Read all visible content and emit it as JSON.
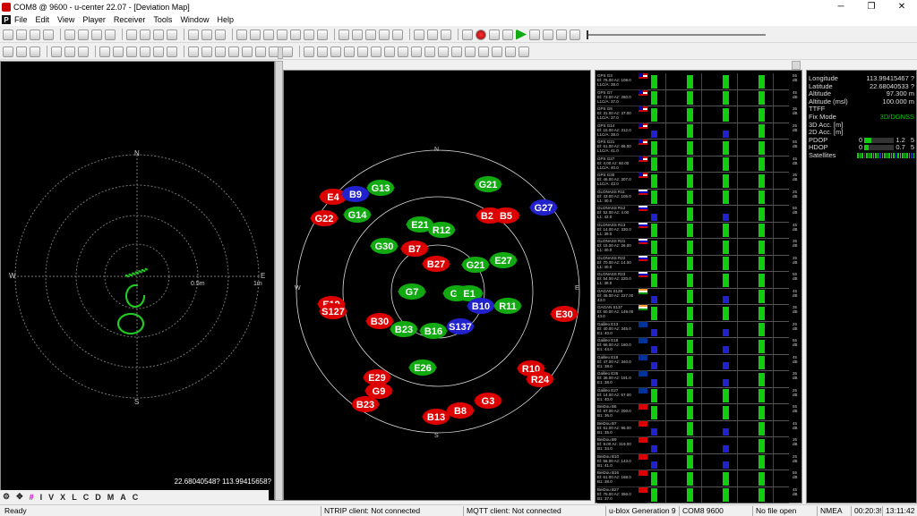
{
  "window": {
    "title": "COM8 @ 9600 - u-center 22.07 - [Deviation Map]"
  },
  "menu": [
    "File",
    "Edit",
    "View",
    "Player",
    "Receiver",
    "Tools",
    "Window",
    "Help"
  ],
  "deviation": {
    "coords": "22.68040548? 113.99415658?",
    "labels": {
      "n": "N",
      "s": "S",
      "e": "E",
      "w": "W",
      "r1": "0.5m",
      "r2": "1m"
    }
  },
  "skyview": {
    "labels": {
      "n": "N",
      "s": "S",
      "e": "E",
      "w": "W"
    },
    "sats": [
      {
        "id": "E4",
        "c": "red"
      },
      {
        "id": "B9",
        "c": "blue"
      },
      {
        "id": "G13",
        "c": "green"
      },
      {
        "id": "G21",
        "c": "green"
      },
      {
        "id": "G27",
        "c": "blue"
      },
      {
        "id": "G22",
        "c": "red"
      },
      {
        "id": "G14",
        "c": "green"
      },
      {
        "id": "E21",
        "c": "green"
      },
      {
        "id": "R12",
        "c": "green"
      },
      {
        "id": "B28",
        "c": "red"
      },
      {
        "id": "B5",
        "c": "red"
      },
      {
        "id": "G30",
        "c": "green"
      },
      {
        "id": "B7",
        "c": "red"
      },
      {
        "id": "B27",
        "c": "red"
      },
      {
        "id": "G21",
        "c": "green"
      },
      {
        "id": "E27",
        "c": "green"
      },
      {
        "id": "G7",
        "c": "green"
      },
      {
        "id": "G6",
        "c": "green"
      },
      {
        "id": "E1",
        "c": "green"
      },
      {
        "id": "B10",
        "c": "blue"
      },
      {
        "id": "R11",
        "c": "green"
      },
      {
        "id": "E19",
        "c": "red"
      },
      {
        "id": "S127",
        "c": "red"
      },
      {
        "id": "E30",
        "c": "red"
      },
      {
        "id": "B30",
        "c": "red"
      },
      {
        "id": "B23",
        "c": "green"
      },
      {
        "id": "B16",
        "c": "green"
      },
      {
        "id": "S137",
        "c": "blue"
      },
      {
        "id": "E26",
        "c": "green"
      },
      {
        "id": "E29",
        "c": "red"
      },
      {
        "id": "G9",
        "c": "red"
      },
      {
        "id": "B23",
        "c": "red"
      },
      {
        "id": "R10",
        "c": "red"
      },
      {
        "id": "R24",
        "c": "red"
      },
      {
        "id": "G3",
        "c": "red"
      },
      {
        "id": "B8",
        "c": "red"
      },
      {
        "id": "B13",
        "c": "red"
      }
    ]
  },
  "satlist": [
    {
      "name": "GPS G3",
      "l2": "El: 76.00 Az: 108.0",
      "l3": "L1C/A: 38.0",
      "flag": "us"
    },
    {
      "name": "GPS G7",
      "l2": "El: 73.00 Az: 260.0",
      "l3": "L1C/A: 37.0",
      "flag": "us"
    },
    {
      "name": "GPS G8",
      "l2": "El: 31.00 Az: 37.00",
      "l3": "L1C/A: 37.0",
      "flag": "us"
    },
    {
      "name": "GPS G14",
      "l2": "El: 15.00 Az: 312.0",
      "l3": "L1C/A: 38.0",
      "flag": "us"
    },
    {
      "name": "GPS G21",
      "l2": "El: 61.00 Az: 86.00",
      "l3": "L1C/A: 41.0",
      "flag": "us"
    },
    {
      "name": "GPS G27",
      "l2": "El: 4.00 Az: 60.00",
      "l3": "L1C/A: 40.0",
      "flag": "us"
    },
    {
      "name": "GPS G30",
      "l2": "El: 46.00 Az: 307.0",
      "l3": "L1C/A: 42.0",
      "flag": "us"
    },
    {
      "name": "GLONASS R11",
      "l2": "El: 43.00 Az: 105.0",
      "l3": "L1: 40.0",
      "flag": "ru"
    },
    {
      "name": "GLONASS R12",
      "l2": "El: 52.00 Az: 4.00",
      "l3": "L1: 42.0",
      "flag": "ru"
    },
    {
      "name": "GLONASS R13",
      "l2": "El: 14.00 Az: 330.0",
      "l3": "L1: 39.0",
      "flag": "ru"
    },
    {
      "name": "GLONASS R21",
      "l2": "El: 15.00 Az: 26.00",
      "l3": "L1: 40.0",
      "flag": "ru"
    },
    {
      "name": "GLONASS R22",
      "l2": "El: 70.00 Az: 14.00",
      "l3": "L1: 40.0",
      "flag": "ru"
    },
    {
      "name": "GLONASS R23",
      "l2": "El: 54.00 Az: 220.0",
      "l3": "L1: 38.0",
      "flag": "ru"
    },
    {
      "name": "GAGAN S128",
      "l2": "El: 46.00 Az: 227.00",
      "l3": "43.0",
      "flag": "in"
    },
    {
      "name": "GAGAN S137",
      "l2": "El: 60.00 Az: 149.00",
      "l3": "43.0",
      "flag": "in"
    },
    {
      "name": "Galileo E13",
      "l2": "El: 40.00 Az: 345.0",
      "l3": "E1: 40.0",
      "flag": "eu"
    },
    {
      "name": "Galileo E18",
      "l2": "El: 66.00 Az: 160.0",
      "l3": "E1: 44.0",
      "flag": "eu"
    },
    {
      "name": "Galileo E19",
      "l2": "El: 47.00 Az: 340.0",
      "l3": "E1: 38.0",
      "flag": "eu"
    },
    {
      "name": "Galileo E26",
      "l2": "El: 36.00 Az: 191.0",
      "l3": "E1: 38.0",
      "flag": "eu"
    },
    {
      "name": "Galileo E27",
      "l2": "El: 14.00 Az: 67.00",
      "l3": "E1: 40.0",
      "flag": "eu"
    },
    {
      "name": "BeiDou B6",
      "l2": "El: 67.00 Az: 200.0",
      "l3": "B1: 36.0",
      "flag": "cn"
    },
    {
      "name": "BeiDou B7",
      "l2": "El: 61.00 Az: 96.00",
      "l3": "B1: 35.0",
      "flag": "cn"
    },
    {
      "name": "BeiDou B9",
      "l2": "El: 9.00 Az: 319.00",
      "l3": "B1: 34.0",
      "flag": "cn"
    },
    {
      "name": "BeiDou B10",
      "l2": "El: 56.00 Az: 143.0",
      "l3": "B1: 41.0",
      "flag": "cn"
    },
    {
      "name": "BeiDou B16",
      "l2": "El: 61.00 Az: 168.0",
      "l3": "B1: 38.0",
      "flag": "cn"
    },
    {
      "name": "BeiDou B27",
      "l2": "El: 75.00 Az: 356.0",
      "l3": "B1: 37.0",
      "flag": "cn"
    }
  ],
  "dbvalues": [
    "55\ndB",
    "45\ndB",
    "35\ndB",
    "25\ndB"
  ],
  "info": {
    "rows": [
      {
        "k": "Longitude",
        "v": "113.99415467 ?"
      },
      {
        "k": "Latitude",
        "v": "22.68040533 ?"
      },
      {
        "k": "Altitude",
        "v": "97.300 m"
      },
      {
        "k": "Altitude (msl)",
        "v": "100.000 m"
      },
      {
        "k": "TTFF",
        "v": ""
      },
      {
        "k": "Fix Mode",
        "v": "3D/DGNSS",
        "fix": true
      },
      {
        "k": "3D Acc. [m]",
        "v": ""
      },
      {
        "k": "2D Acc. [m]",
        "v": ""
      }
    ],
    "pdop": {
      "k": "PDOP",
      "min": "0",
      "val": "1.2",
      "max": "5",
      "level": 0.24
    },
    "hdop": {
      "k": "HDOP",
      "min": "0",
      "val": "0.7",
      "max": "5",
      "level": 0.14
    },
    "satellites": {
      "k": "Satellites"
    }
  },
  "bottombar": [
    "I",
    "V",
    "X",
    "L",
    "C",
    "D",
    "M",
    "A",
    "C"
  ],
  "status": {
    "ready": "Ready",
    "ntrip": "NTRIP client: Not connected",
    "mqtt": "MQTT client: Not connected",
    "gen": "u-blox Generation 9",
    "com": "COM8 9600",
    "file": "No file open",
    "nmea": "NMEA",
    "time1": "00:20:39",
    "time2": "13:11:42"
  }
}
